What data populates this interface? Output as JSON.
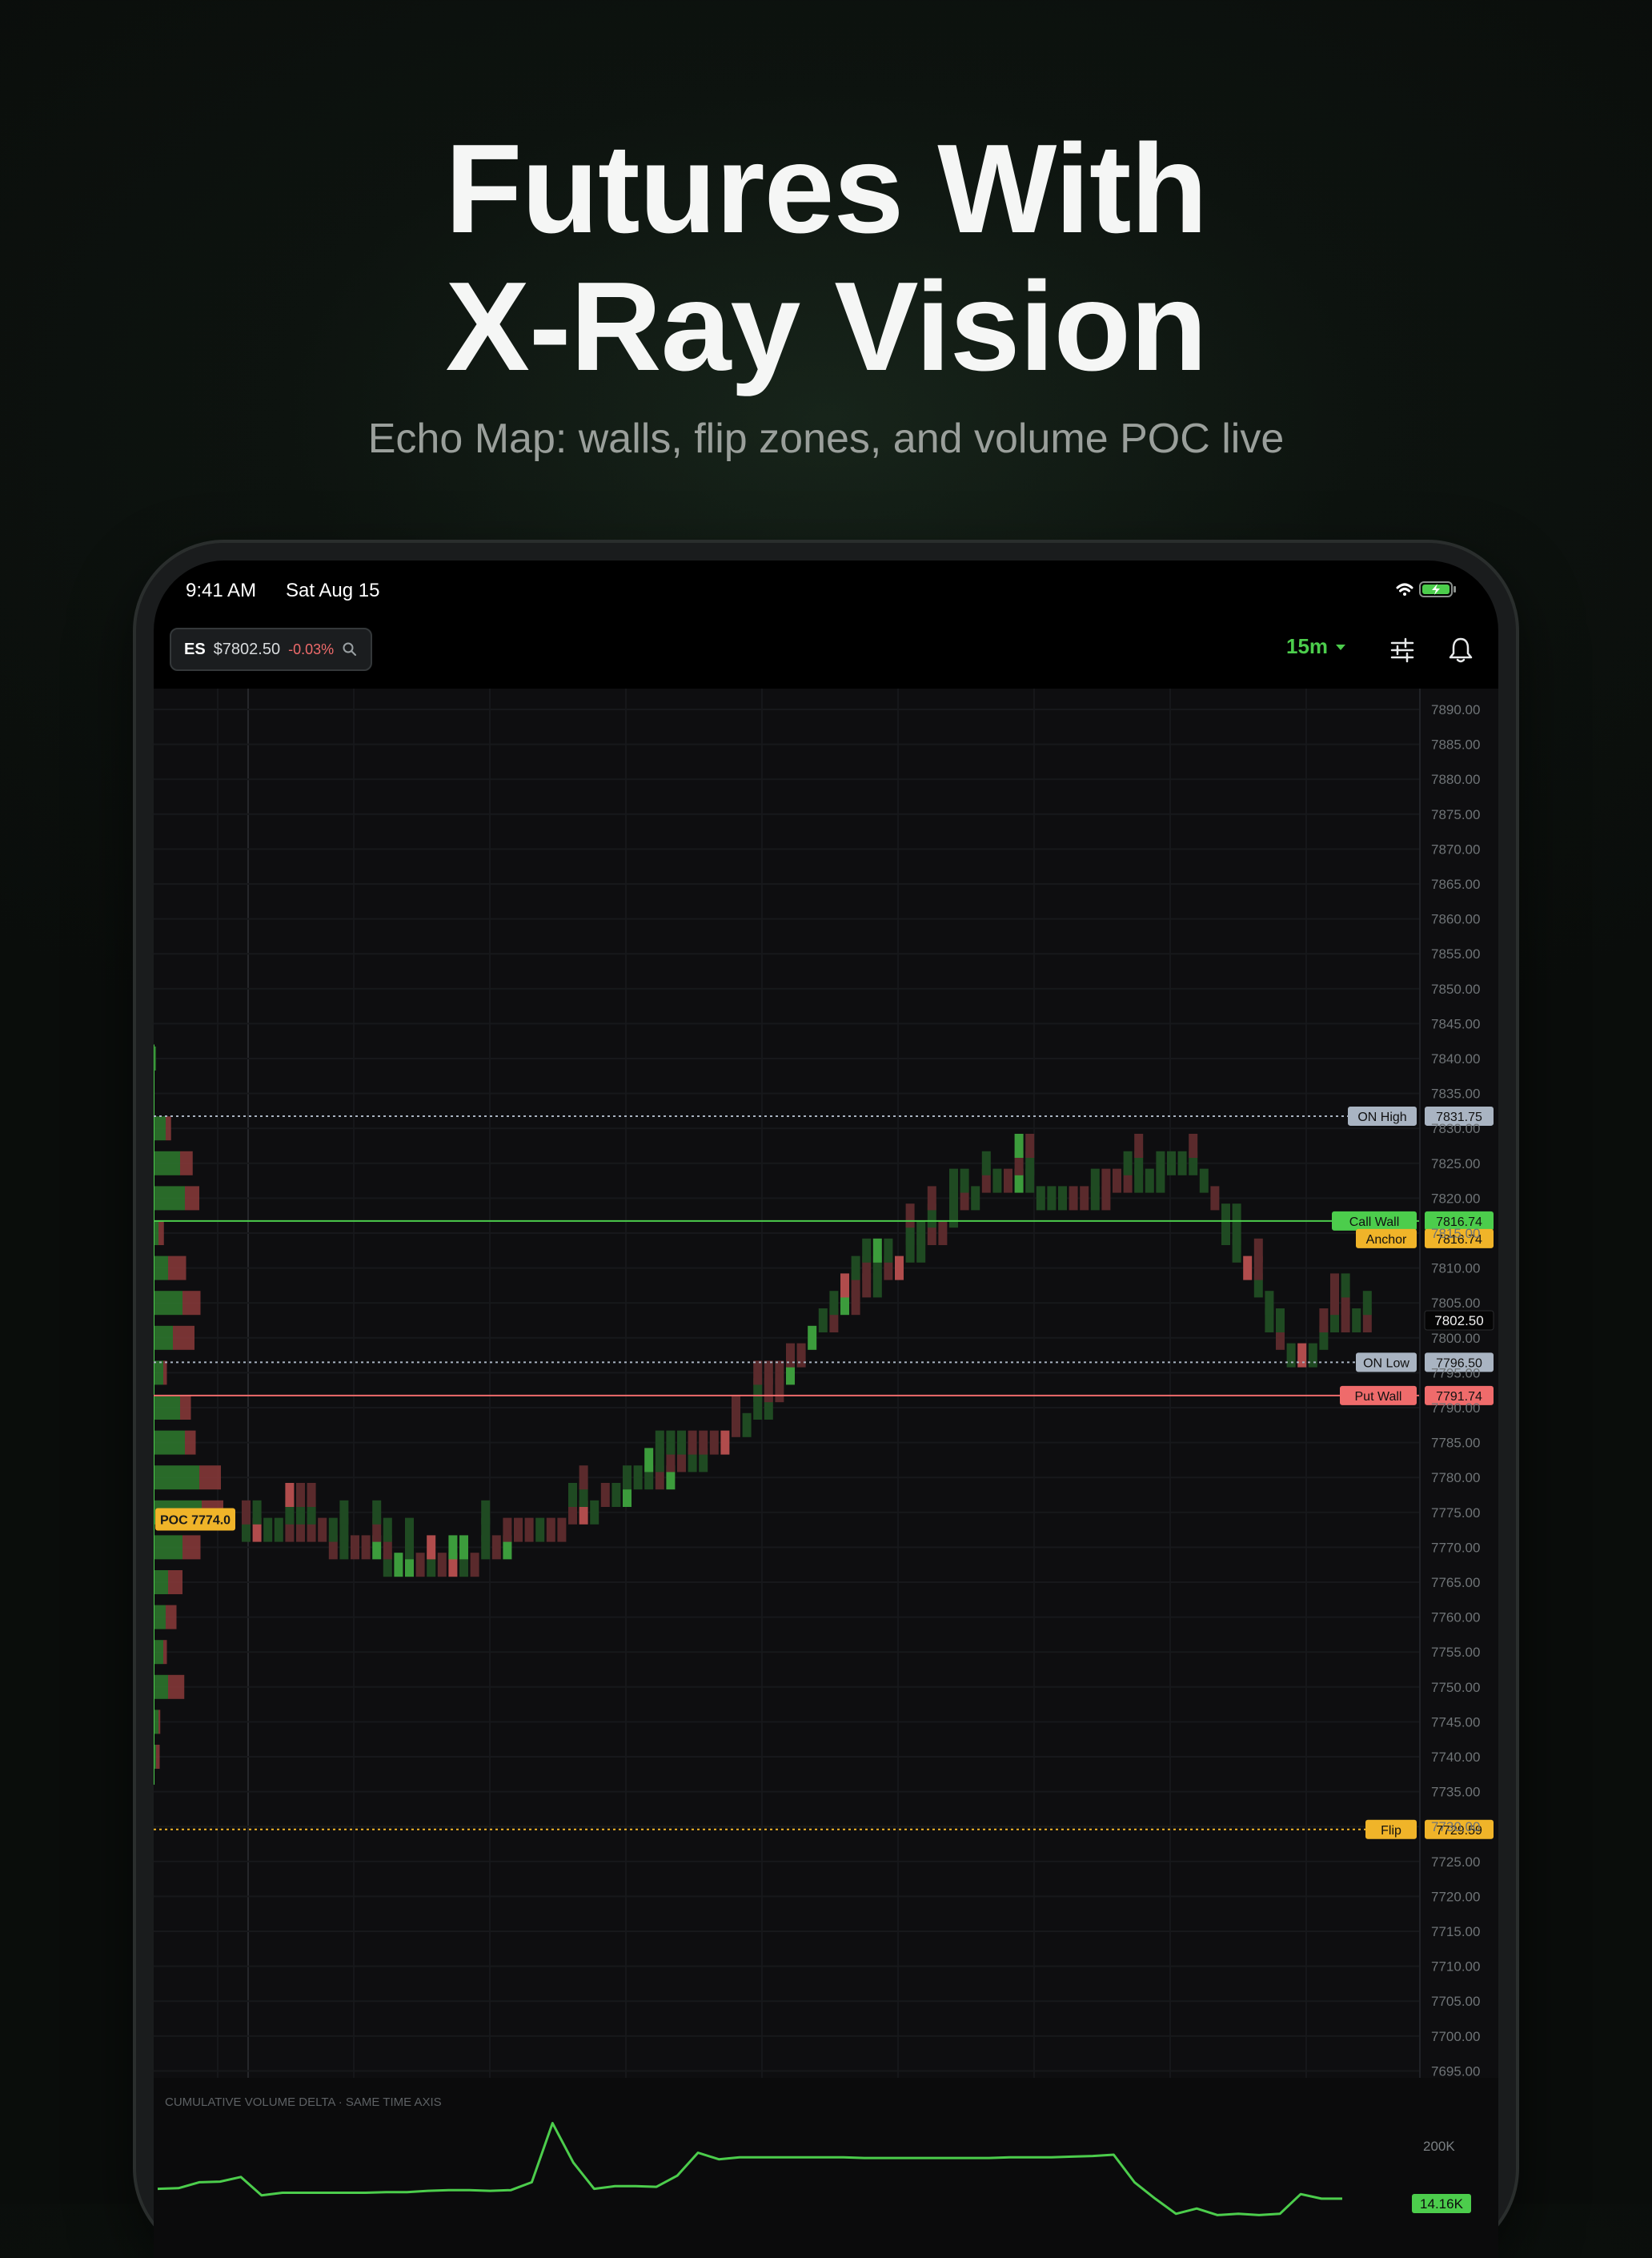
{
  "hero": {
    "title_line1": "Futures With",
    "title_line2": "X-Ray Vision",
    "subtitle": "Echo Map: walls, flip zones, and volume POC live"
  },
  "status_bar": {
    "time": "9:41 AM",
    "date": "Sat Aug 15",
    "icons": [
      "wifi-icon",
      "battery-charging-icon"
    ]
  },
  "toolbar": {
    "symbol": "ES",
    "price": "$7802.50",
    "change": "-0.03%",
    "timeframe": "15m",
    "icons": [
      "search-icon",
      "chevron-down-icon",
      "sliders-icon",
      "bell-icon"
    ]
  },
  "colors": {
    "up": "#4ccd4c",
    "down": "#ef6b6b",
    "anchor": "#f0b429",
    "neutral_level": "#a9b4c2",
    "background": "#0b0b0c"
  },
  "chart_data": {
    "type": "heatmap",
    "y_axis_ticks": [
      "7890.00",
      "7885.00",
      "7880.00",
      "7875.00",
      "7870.00",
      "7865.00",
      "7860.00",
      "7855.00",
      "7850.00",
      "7845.00",
      "7840.00",
      "7835.00",
      "7830.00",
      "7825.00",
      "7820.00",
      "7815.00",
      "7810.00",
      "7805.00",
      "7800.00",
      "7795.00",
      "7790.00",
      "7785.00",
      "7780.00",
      "7775.00",
      "7770.00",
      "7765.00",
      "7760.00",
      "7755.00",
      "7750.00",
      "7745.00",
      "7740.00",
      "7735.00",
      "7730.00",
      "7725.00",
      "7720.00",
      "7715.00",
      "7710.00",
      "7705.00",
      "7700.00",
      "7695.00"
    ],
    "ylim": [
      7695,
      7890
    ],
    "last_price": "7802.50",
    "poc_label": "POC 7774.0",
    "levels": [
      {
        "label": "ON High",
        "value": "7831.75",
        "style": "dotted",
        "color": "#a9b4c2"
      },
      {
        "label": "Call Wall",
        "value": "7816.74",
        "style": "solid",
        "color": "#4ccd4c"
      },
      {
        "label": "Anchor",
        "value": "7816.74",
        "style": "none",
        "color": "#f0b429"
      },
      {
        "label": "ON Low",
        "value": "7796.50",
        "style": "dotted",
        "color": "#a9b4c2"
      },
      {
        "label": "Put Wall",
        "value": "7791.74",
        "style": "solid",
        "color": "#ef6b6b"
      },
      {
        "label": "Flip",
        "value": "7729.59",
        "style": "dotted",
        "color": "#f0b429"
      }
    ],
    "price_path": [
      [
        0,
        7776
      ],
      [
        4,
        7776
      ],
      [
        7,
        7774
      ],
      [
        10,
        7772
      ],
      [
        13,
        7771
      ],
      [
        16,
        7770
      ],
      [
        19,
        7769
      ],
      [
        22,
        7772
      ],
      [
        25,
        7774
      ],
      [
        28,
        7775
      ],
      [
        31,
        7778
      ],
      [
        34,
        7780
      ],
      [
        37,
        7782
      ],
      [
        40,
        7784
      ],
      [
        43,
        7787
      ],
      [
        46,
        7790
      ],
      [
        48,
        7793
      ],
      [
        50,
        7798
      ],
      [
        52,
        7803
      ],
      [
        54,
        7806
      ],
      [
        56,
        7808
      ],
      [
        58,
        7811
      ],
      [
        60,
        7813
      ],
      [
        62,
        7815
      ],
      [
        64,
        7818
      ],
      [
        66,
        7822
      ],
      [
        68,
        7824
      ],
      [
        70,
        7824
      ],
      [
        72,
        7824
      ],
      [
        74,
        7823
      ],
      [
        76,
        7823
      ],
      [
        78,
        7823
      ],
      [
        80,
        7824
      ],
      [
        82,
        7826
      ],
      [
        84,
        7826
      ],
      [
        86,
        7827
      ],
      [
        88,
        7826
      ],
      [
        90,
        7818
      ],
      [
        92,
        7812
      ],
      [
        94,
        7806
      ],
      [
        96,
        7801
      ],
      [
        98,
        7800
      ],
      [
        100,
        7804
      ],
      [
        102,
        7806
      ],
      [
        104,
        7803
      ]
    ],
    "volume_profile": [
      {
        "price": 7840,
        "green": 0.05,
        "red": 0
      },
      {
        "price": 7830,
        "green": 0.25,
        "red": 0.15
      },
      {
        "price": 7825,
        "green": 0.55,
        "red": 0.35
      },
      {
        "price": 7820,
        "green": 0.65,
        "red": 0.4
      },
      {
        "price": 7815,
        "green": 0.1,
        "red": 0.15
      },
      {
        "price": 7810,
        "green": 0.3,
        "red": 0.5
      },
      {
        "price": 7805,
        "green": 0.6,
        "red": 0.5
      },
      {
        "price": 7800,
        "green": 0.4,
        "red": 0.6
      },
      {
        "price": 7795,
        "green": 0.2,
        "red": 0.1
      },
      {
        "price": 7790,
        "green": 0.55,
        "red": 0.3
      },
      {
        "price": 7785,
        "green": 0.65,
        "red": 0.3
      },
      {
        "price": 7780,
        "green": 0.95,
        "red": 0.6
      },
      {
        "price": 7775,
        "green": 1.0,
        "red": 0.6
      },
      {
        "price": 7770,
        "green": 0.6,
        "red": 0.5
      },
      {
        "price": 7765,
        "green": 0.3,
        "red": 0.4
      },
      {
        "price": 7760,
        "green": 0.25,
        "red": 0.3
      },
      {
        "price": 7755,
        "green": 0.2,
        "red": 0.1
      },
      {
        "price": 7750,
        "green": 0.3,
        "red": 0.45
      },
      {
        "price": 7745,
        "green": 0.1,
        "red": 0.05
      },
      {
        "price": 7740,
        "green": 0.05,
        "red": 0.1
      }
    ],
    "cvd": {
      "title": "CUMULATIVE VOLUME DELTA · SAME TIME AXIS",
      "axis_label": "200K",
      "last_value": "14.16K",
      "values": [
        20,
        21,
        30,
        31,
        38,
        10,
        14,
        14,
        14,
        14,
        14,
        15,
        15,
        17,
        18,
        18,
        17,
        18,
        30,
        120,
        60,
        20,
        24,
        24,
        23,
        40,
        75,
        65,
        68,
        68,
        68,
        68,
        68,
        68,
        67,
        67,
        67,
        67,
        67,
        67,
        67,
        68,
        68,
        68,
        69,
        70,
        72,
        30,
        5,
        -18,
        -10,
        -20,
        -18,
        -20,
        -18,
        12,
        5,
        5
      ]
    }
  }
}
